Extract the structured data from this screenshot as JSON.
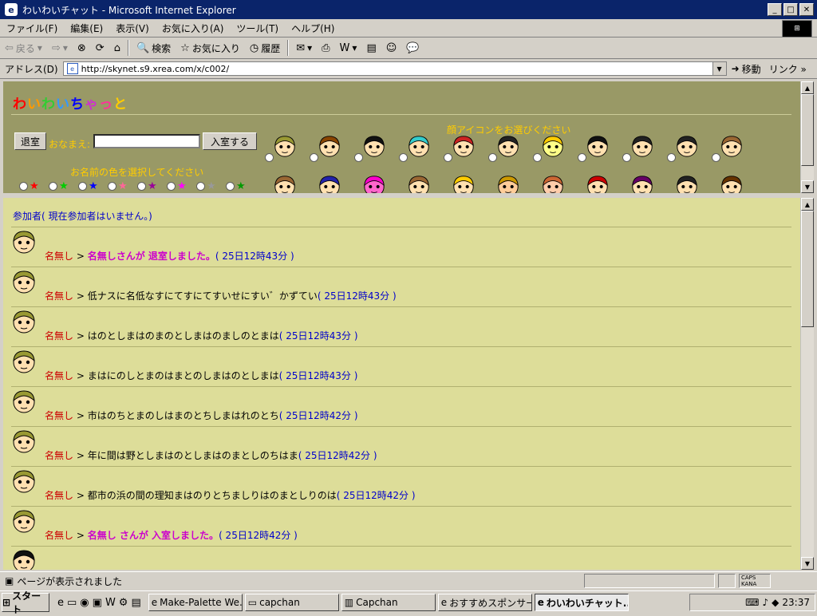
{
  "window": {
    "title": "わいわいチャット - Microsoft Internet Explorer"
  },
  "menu": [
    "ファイル(F)",
    "編集(E)",
    "表示(V)",
    "お気に入り(A)",
    "ツール(T)",
    "ヘルプ(H)"
  ],
  "toolbar": {
    "back": "戻る",
    "search": "検索",
    "favorites": "お気に入り",
    "history": "履歴"
  },
  "address": {
    "label": "アドレス(D)",
    "url": "http://skynet.s9.xrea.com/x/c002/",
    "go": "移動",
    "links": "リンク"
  },
  "chat_top": {
    "logo": [
      "わ",
      "い",
      "わ",
      "い",
      "ち",
      "ゃ",
      "っ",
      "と"
    ],
    "logo_colors": [
      "#ff0000",
      "#ff9900",
      "#33cc33",
      "#3399ff",
      "#0000ff",
      "#cc33cc",
      "#ff3399",
      "#ffcc00"
    ],
    "exit_button": "退室",
    "name_label": "おなまえ:",
    "name_value": "",
    "enter_button": "入室する",
    "icon_prompt": "顔アイコンをお選びください",
    "color_prompt": "お名前の色を選択してください",
    "name_colors": [
      "#ff0000",
      "#00cc00",
      "#0000ff",
      "#ff6699",
      "#990099",
      "#ff00ff",
      "#999999",
      "#009900"
    ]
  },
  "chat_log": {
    "participants": "参加者( 現在参加者はいません。)",
    "messages": [
      {
        "name": "名無し",
        "sep": " > ",
        "text": "名無しさんが 退室しました。",
        "system": true,
        "time": "( 25日12時43分 )"
      },
      {
        "name": "名無し",
        "sep": " > ",
        "text": "低ナスに名低なすにてすにてすいせにすい゛かずてい",
        "system": false,
        "time": "( 25日12時43分 )"
      },
      {
        "name": "名無し",
        "sep": " > ",
        "text": "はのとしまはのまのとしまはのましのとまは",
        "system": false,
        "time": "( 25日12時43分 )"
      },
      {
        "name": "名無し",
        "sep": " > ",
        "text": "まはにのしとまのはまとのしまはのとしまは",
        "system": false,
        "time": "( 25日12時43分 )"
      },
      {
        "name": "名無し",
        "sep": " > ",
        "text": "市はのちとまのしはまのとちしまはれのとち",
        "system": false,
        "time": "( 25日12時42分 )"
      },
      {
        "name": "名無し",
        "sep": " > ",
        "text": "年に間は野としまはのとしまはのまとしのちはま",
        "system": false,
        "time": "( 25日12時42分 )"
      },
      {
        "name": "名無し",
        "sep": " > ",
        "text": "都市の浜の間の理知まはのりとちましりはのまとしりのは",
        "system": false,
        "time": "( 25日12時42分 )"
      },
      {
        "name": "名無し",
        "sep": " > ",
        "text": "名無し さんが 入室しました。",
        "system": true,
        "time": "( 25日12時42分 )"
      }
    ]
  },
  "statusbar": {
    "text": "ページが表示されました",
    "caps": "CAPS",
    "kana": "KANA"
  },
  "taskbar": {
    "start": "スタート",
    "tasks": [
      "Make-Palette We...",
      "capchan",
      "Capchan",
      "おすすめスポンサー...",
      "わいわいチャット..."
    ],
    "clock": "23:37"
  }
}
